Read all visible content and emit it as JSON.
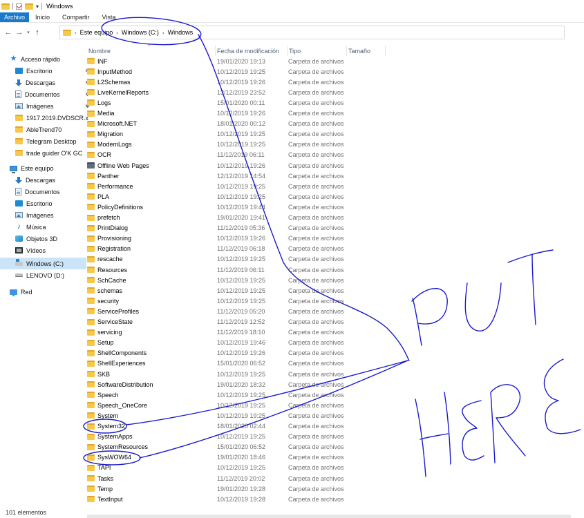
{
  "window": {
    "title": "Windows"
  },
  "ribbon": {
    "tabs": [
      "Archivo",
      "Inicio",
      "Compartir",
      "Vista"
    ]
  },
  "address": {
    "crumbs": [
      "Este equipo",
      "Windows (C:)",
      "Windows"
    ]
  },
  "nav": {
    "items": [
      {
        "label": "Acceso rápido",
        "icon": "star-icon",
        "pinned": false
      },
      {
        "label": "Escritorio",
        "icon": "desktop-icon",
        "pinned": true
      },
      {
        "label": "Descargas",
        "icon": "downloads-icon",
        "pinned": true
      },
      {
        "label": "Documentos",
        "icon": "documents-icon",
        "pinned": true
      },
      {
        "label": "Imágenes",
        "icon": "pictures-icon",
        "pinned": true
      },
      {
        "label": "1917.2019.DVDSCR.x",
        "icon": "folder-icon",
        "pinned": false
      },
      {
        "label": "AbleTrend70",
        "icon": "folder-icon",
        "pinned": false
      },
      {
        "label": "Telegram Desktop",
        "icon": "folder-icon",
        "pinned": false
      },
      {
        "label": "trade guider O'K GC",
        "icon": "folder-icon",
        "pinned": false
      },
      {
        "label": "Este equipo",
        "icon": "this-pc-icon",
        "pinned": false
      },
      {
        "label": "Descargas",
        "icon": "downloads-icon",
        "pinned": false
      },
      {
        "label": "Documentos",
        "icon": "documents-icon",
        "pinned": false
      },
      {
        "label": "Escritorio",
        "icon": "desktop-icon",
        "pinned": false
      },
      {
        "label": "Imágenes",
        "icon": "pictures-icon",
        "pinned": false
      },
      {
        "label": "Música",
        "icon": "music-icon",
        "pinned": false
      },
      {
        "label": "Objetos 3D",
        "icon": "objects-3d-icon",
        "pinned": false
      },
      {
        "label": "Vídeos",
        "icon": "videos-icon",
        "pinned": false
      },
      {
        "label": "Windows (C:)",
        "icon": "windows-drive-icon",
        "pinned": false
      },
      {
        "label": "LENOVO (D:)",
        "icon": "drive-icon",
        "pinned": false
      },
      {
        "label": "Red",
        "icon": "network-icon",
        "pinned": false
      }
    ]
  },
  "columns": [
    "Nombre",
    "Fecha de modificación",
    "Tipo",
    "Tamaño"
  ],
  "files": [
    {
      "name": "INF",
      "date": "19/01/2020 19:13",
      "type": "Carpeta de archivos"
    },
    {
      "name": "InputMethod",
      "date": "10/12/2019 19:25",
      "type": "Carpeta de archivos"
    },
    {
      "name": "L2Schemas",
      "date": "10/12/2019 19:26",
      "type": "Carpeta de archivos"
    },
    {
      "name": "LiveKernelReports",
      "date": "13/12/2019 23:52",
      "type": "Carpeta de archivos"
    },
    {
      "name": "Logs",
      "date": "15/01/2020 00:11",
      "type": "Carpeta de archivos"
    },
    {
      "name": "Media",
      "date": "10/12/2019 19:26",
      "type": "Carpeta de archivos"
    },
    {
      "name": "Microsoft.NET",
      "date": "18/01/2020 00:12",
      "type": "Carpeta de archivos"
    },
    {
      "name": "Migration",
      "date": "10/12/2019 19:25",
      "type": "Carpeta de archivos"
    },
    {
      "name": "ModemLogs",
      "date": "10/12/2019 19:25",
      "type": "Carpeta de archivos"
    },
    {
      "name": "OCR",
      "date": "11/12/2019 06:11",
      "type": "Carpeta de archivos"
    },
    {
      "name": "Offline Web Pages",
      "date": "10/12/2019 19:26",
      "type": "Carpeta de archivos",
      "special": true
    },
    {
      "name": "Panther",
      "date": "12/12/2019 14:54",
      "type": "Carpeta de archivos"
    },
    {
      "name": "Performance",
      "date": "10/12/2019 19:25",
      "type": "Carpeta de archivos"
    },
    {
      "name": "PLA",
      "date": "10/12/2019 19:25",
      "type": "Carpeta de archivos"
    },
    {
      "name": "PolicyDefinitions",
      "date": "10/12/2019 19:44",
      "type": "Carpeta de archivos"
    },
    {
      "name": "prefetch",
      "date": "19/01/2020 19:41",
      "type": "Carpeta de archivos"
    },
    {
      "name": "PrintDialog",
      "date": "11/12/2019 05:36",
      "type": "Carpeta de archivos"
    },
    {
      "name": "Provisioning",
      "date": "10/12/2019 19:26",
      "type": "Carpeta de archivos"
    },
    {
      "name": "Registration",
      "date": "11/12/2019 06:18",
      "type": "Carpeta de archivos"
    },
    {
      "name": "rescache",
      "date": "10/12/2019 19:25",
      "type": "Carpeta de archivos"
    },
    {
      "name": "Resources",
      "date": "11/12/2019 06:11",
      "type": "Carpeta de archivos"
    },
    {
      "name": "SchCache",
      "date": "10/12/2019 19:25",
      "type": "Carpeta de archivos"
    },
    {
      "name": "schemas",
      "date": "10/12/2019 19:25",
      "type": "Carpeta de archivos"
    },
    {
      "name": "security",
      "date": "10/12/2019 19:25",
      "type": "Carpeta de archivos"
    },
    {
      "name": "ServiceProfiles",
      "date": "11/12/2019 05:20",
      "type": "Carpeta de archivos"
    },
    {
      "name": "ServiceState",
      "date": "11/12/2019 12:52",
      "type": "Carpeta de archivos"
    },
    {
      "name": "servicing",
      "date": "11/12/2019 18:10",
      "type": "Carpeta de archivos"
    },
    {
      "name": "Setup",
      "date": "10/12/2019 19:46",
      "type": "Carpeta de archivos"
    },
    {
      "name": "ShellComponents",
      "date": "10/12/2019 19:26",
      "type": "Carpeta de archivos"
    },
    {
      "name": "ShellExperiences",
      "date": "15/01/2020 06:52",
      "type": "Carpeta de archivos"
    },
    {
      "name": "SKB",
      "date": "10/12/2019 19:25",
      "type": "Carpeta de archivos"
    },
    {
      "name": "SoftwareDistribution",
      "date": "19/01/2020 18:32",
      "type": "Carpeta de archivos"
    },
    {
      "name": "Speech",
      "date": "10/12/2019 19:25",
      "type": "Carpeta de archivos"
    },
    {
      "name": "Speech_OneCore",
      "date": "10/12/2019 19:25",
      "type": "Carpeta de archivos"
    },
    {
      "name": "System",
      "date": "10/12/2019 19:25",
      "type": "Carpeta de archivos"
    },
    {
      "name": "System32",
      "date": "18/01/2020 02:44",
      "type": "Carpeta de archivos"
    },
    {
      "name": "SystemApps",
      "date": "10/12/2019 19:25",
      "type": "Carpeta de archivos"
    },
    {
      "name": "SystemResources",
      "date": "15/01/2020 06:52",
      "type": "Carpeta de archivos"
    },
    {
      "name": "SysWOW64",
      "date": "19/01/2020 18:46",
      "type": "Carpeta de archivos"
    },
    {
      "name": "TAPI",
      "date": "10/12/2019 19:25",
      "type": "Carpeta de archivos"
    },
    {
      "name": "Tasks",
      "date": "11/12/2019 20:02",
      "type": "Carpeta de archivos"
    },
    {
      "name": "Temp",
      "date": "19/01/2020 19:28",
      "type": "Carpeta de archivos"
    },
    {
      "name": "TextInput",
      "date": "10/12/2019 19:28",
      "type": "Carpeta de archivos"
    }
  ],
  "status": {
    "count": "101 elementos"
  },
  "annotation": {
    "color": "#1a1acd",
    "text": "PUT HERE"
  }
}
